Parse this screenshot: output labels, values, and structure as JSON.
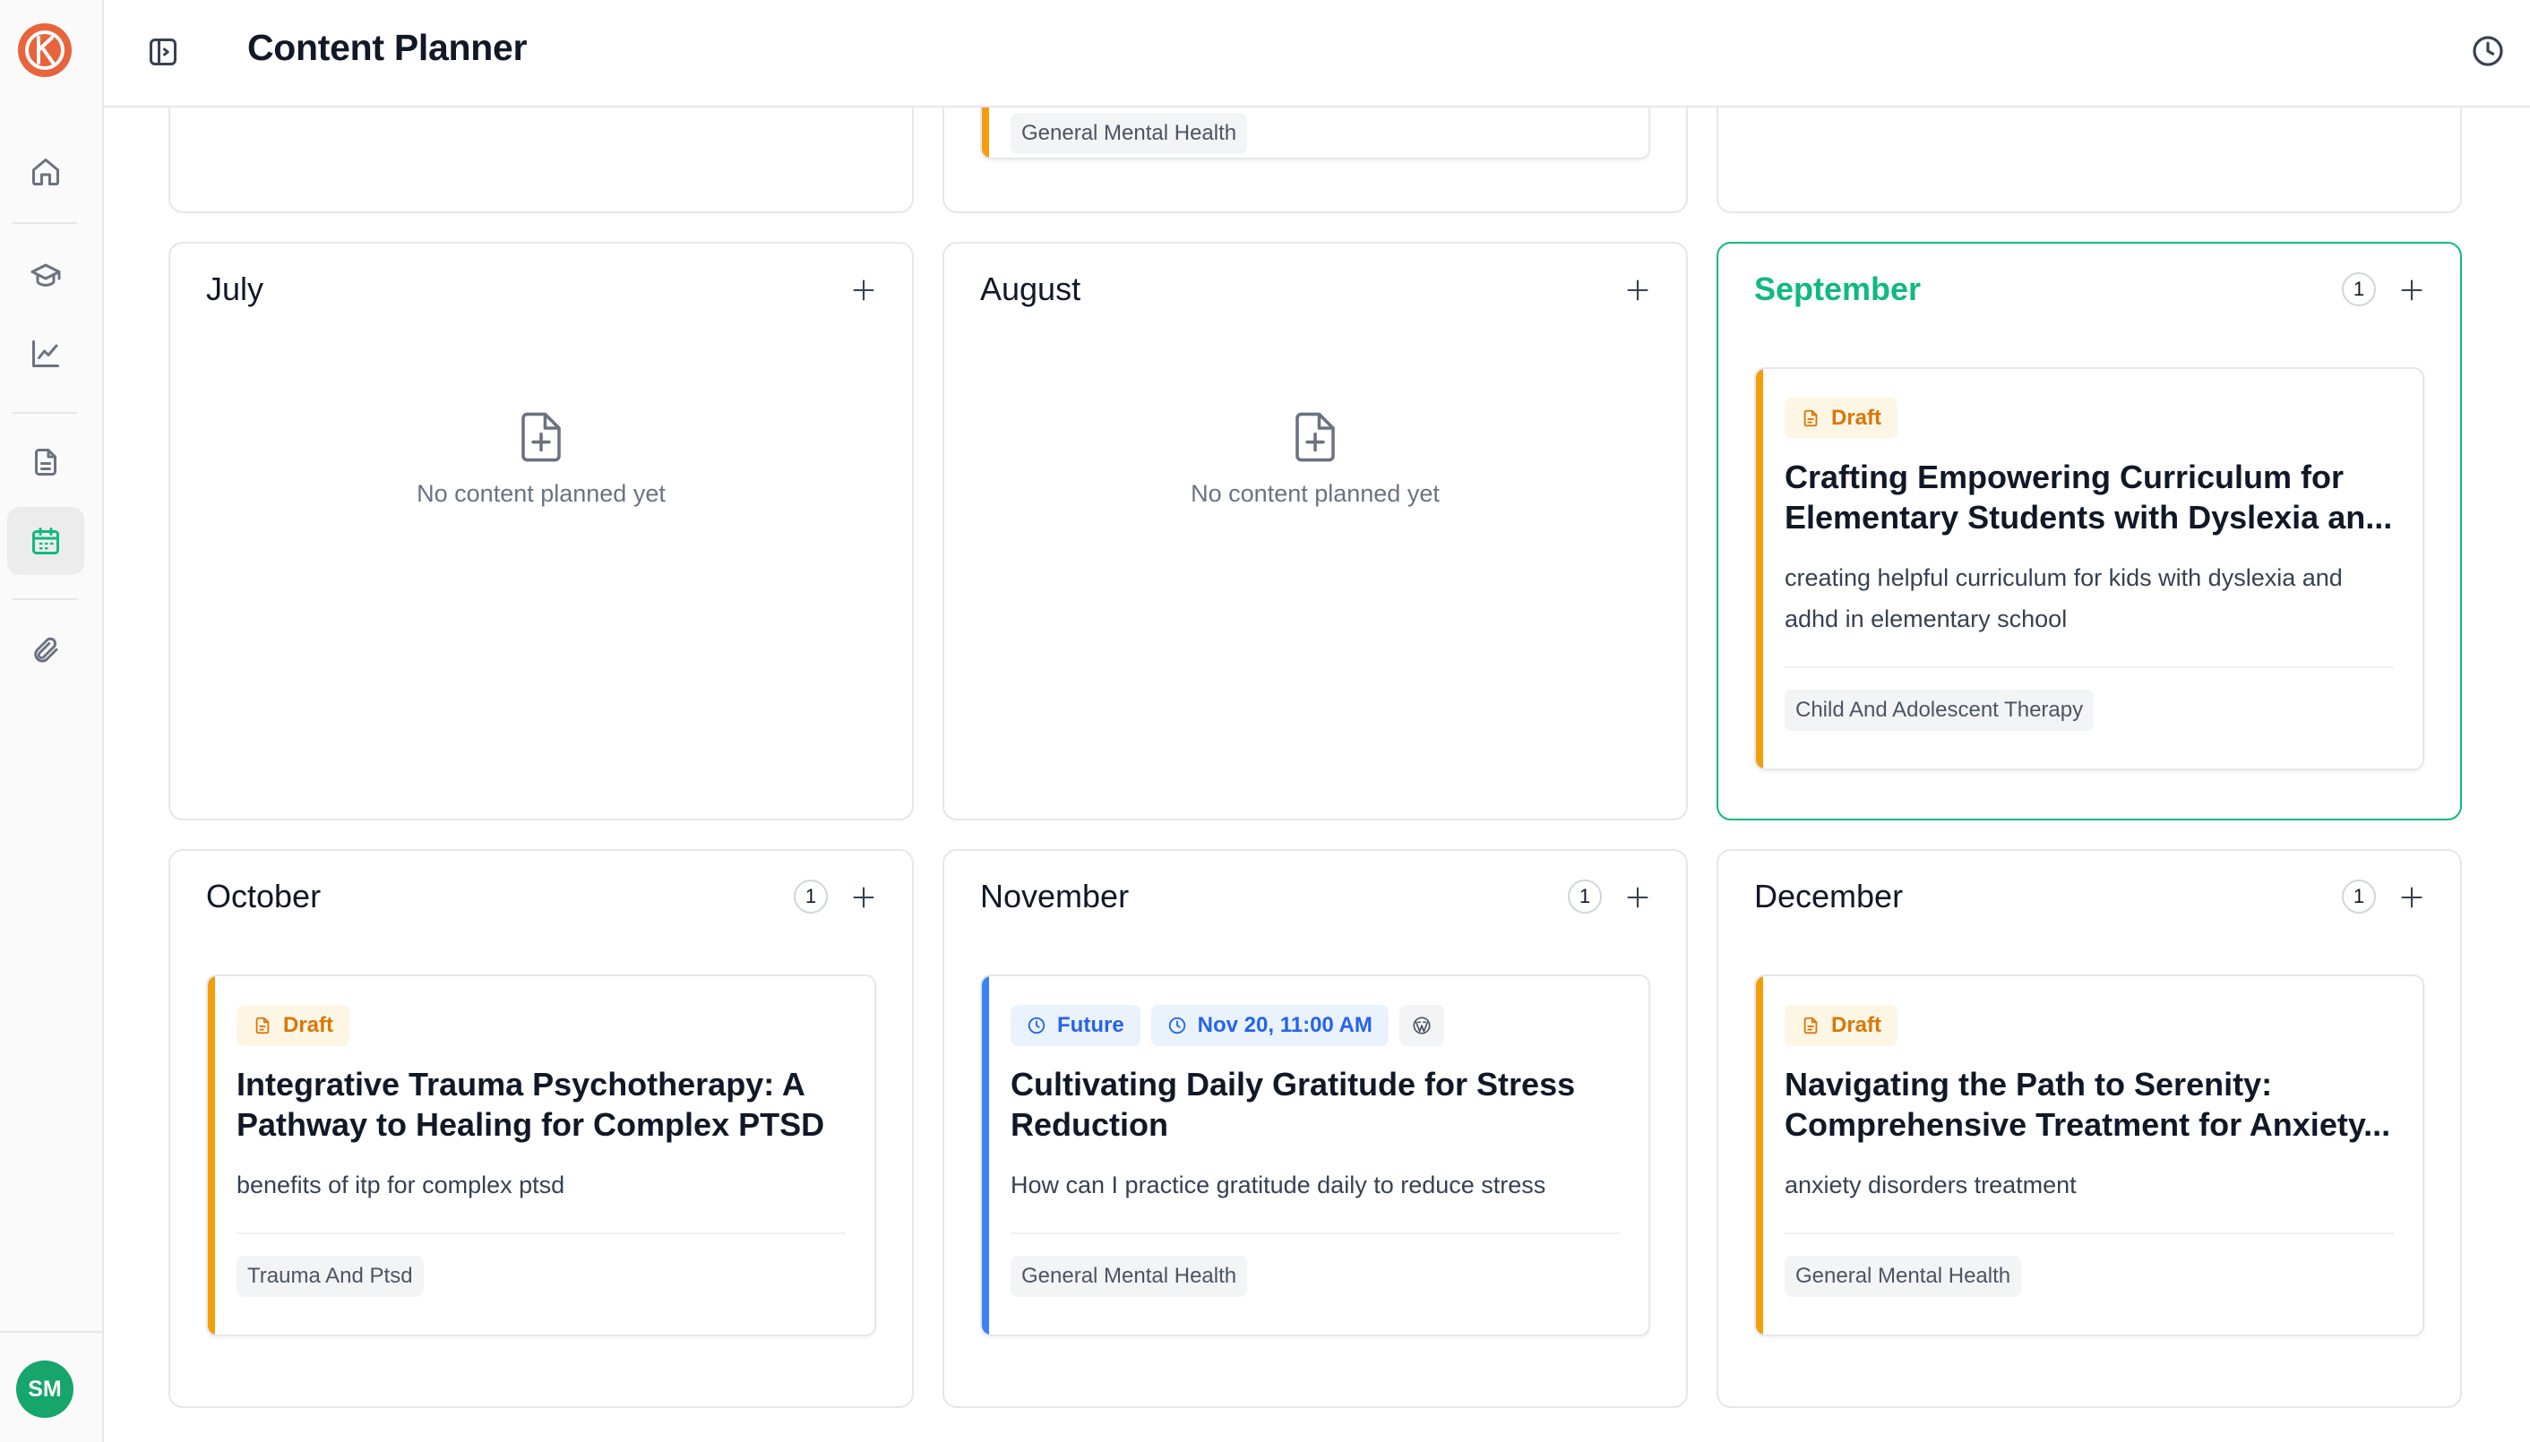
{
  "header": {
    "title": "Content Planner"
  },
  "user": {
    "initials": "SM"
  },
  "empty_text": "No content planned yet",
  "top_card": {
    "category": "General Mental Health"
  },
  "months": {
    "july": {
      "name": "July"
    },
    "august": {
      "name": "August"
    },
    "september": {
      "name": "September",
      "count": "1",
      "card": {
        "status": "Draft",
        "title": "Crafting Empowering Curriculum for Elementary Students with Dyslexia an...",
        "description": "creating helpful curriculum for kids with dyslexia and adhd in elementary school",
        "category": "Child And Adolescent Therapy"
      }
    },
    "october": {
      "name": "October",
      "count": "1",
      "card": {
        "status": "Draft",
        "title": "Integrative Trauma Psychotherapy: A Pathway to Healing for Complex PTSD",
        "description": "benefits of itp for complex ptsd",
        "category": "Trauma And Ptsd"
      }
    },
    "november": {
      "name": "November",
      "count": "1",
      "card": {
        "status": "Future",
        "scheduled": "Nov 20, 11:00 AM",
        "title": "Cultivating Daily Gratitude for Stress Reduction",
        "description": "How can I practice gratitude daily to reduce stress",
        "category": "General Mental Health"
      }
    },
    "december": {
      "name": "December",
      "count": "1",
      "card": {
        "status": "Draft",
        "title": "Navigating the Path to Serenity: Comprehensive Treatment for Anxiety...",
        "description": "anxiety disorders treatment",
        "category": "General Mental Health"
      }
    }
  },
  "colors": {
    "accent_green": "#10b981",
    "draft": "#f59e0b",
    "future": "#3b82f6",
    "logo": "#e8643c"
  }
}
